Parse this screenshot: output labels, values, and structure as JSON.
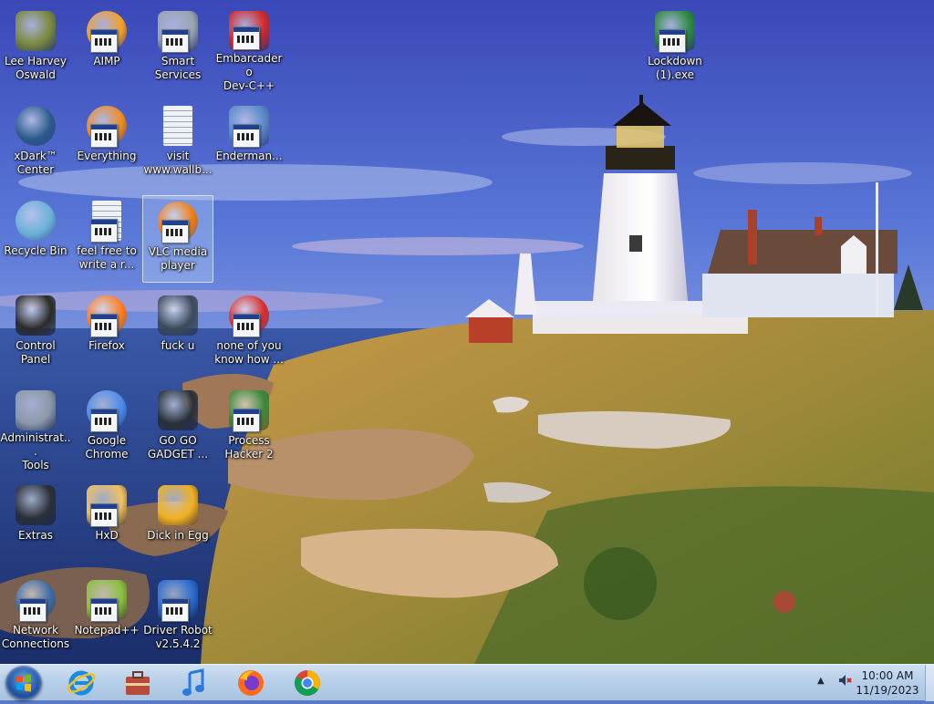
{
  "desktop": {
    "icons": [
      {
        "label": "Lee Harvey\nOswald",
        "icon": "character-icon",
        "color": "#7a8a3a"
      },
      {
        "label": "AIMP",
        "icon": "aimp-icon",
        "color": "#f5a020"
      },
      {
        "label": "Smart\nServices",
        "icon": "gears-icon",
        "color": "#9aa4b0"
      },
      {
        "label": "Embarcadero\nDev-C++",
        "icon": "devcpp-icon",
        "color": "#d42a2a"
      },
      {
        "label": "Lockdown\n(1).exe",
        "icon": "shield-icon",
        "color": "#2a8a3a"
      },
      {
        "label": "xDark™\nCenter",
        "icon": "xdark-icon",
        "color": "#2a5a8a"
      },
      {
        "label": "Everything",
        "icon": "everything-icon",
        "color": "#f08a1a"
      },
      {
        "label": "visit\nwww.wallb...",
        "icon": "text-file-icon",
        "color": "#d8dde4"
      },
      {
        "label": "Enderman...",
        "icon": "window-icon",
        "color": "#5a8ac8"
      },
      {
        "label": "Recycle Bin",
        "icon": "recycle-bin-icon",
        "color": "#6ab0d8"
      },
      {
        "label": "feel free to\nwrite a r...",
        "icon": "text-file-icon",
        "color": "#d8dde4"
      },
      {
        "label": "VLC media\nplayer",
        "icon": "vlc-icon",
        "color": "#f07a10"
      },
      {
        "label": "Control Panel",
        "icon": "control-panel-icon",
        "color": "#2a2a2a"
      },
      {
        "label": "Firefox",
        "icon": "firefox-icon",
        "color": "#ff7a1a"
      },
      {
        "label": "fuck u",
        "icon": "folder-icon",
        "color": "#3a4a5a"
      },
      {
        "label": "none of you\nknow how ...",
        "icon": "red-arrow-icon",
        "color": "#d82a2a"
      },
      {
        "label": "Administrat...\nTools",
        "icon": "admin-tools-icon",
        "color": "#8a98a8"
      },
      {
        "label": "Google\nChrome",
        "icon": "chrome-icon",
        "color": "#4a8af0"
      },
      {
        "label": "GO GO\nGADGET ...",
        "icon": "pc-tower-icon",
        "color": "#2a3038"
      },
      {
        "label": "Process\nHacker 2",
        "icon": "process-hacker-icon",
        "color": "#3a8a3a"
      },
      {
        "label": "Extras",
        "icon": "extras-icon",
        "color": "#2a3038"
      },
      {
        "label": "HxD",
        "icon": "hxd-icon",
        "color": "#f0c060"
      },
      {
        "label": "Dick in Egg",
        "icon": "egg-icon",
        "color": "#f0b020"
      },
      {
        "label": "Network\nConnections",
        "icon": "network-icon",
        "color": "#3a6aa8"
      },
      {
        "label": "Notepad++",
        "icon": "notepad-icon",
        "color": "#8ac040"
      },
      {
        "label": "Driver Robot\nv2.5.4.2",
        "icon": "driver-robot-icon",
        "color": "#2a6ad0"
      }
    ]
  },
  "taskbar": {
    "start": "start-orb",
    "pinned": [
      {
        "name": "ie-icon",
        "color": "#1a8ae0"
      },
      {
        "name": "briefcase-icon",
        "color": "#b84a3a"
      },
      {
        "name": "music-icon",
        "color": "#2a7ae0"
      },
      {
        "name": "firefox-icon",
        "color": "#ff6a1a"
      },
      {
        "name": "chrome-icon",
        "color": "#3a8af0"
      }
    ],
    "clock": {
      "time": "10:00 AM",
      "date": "11/19/2023"
    }
  }
}
